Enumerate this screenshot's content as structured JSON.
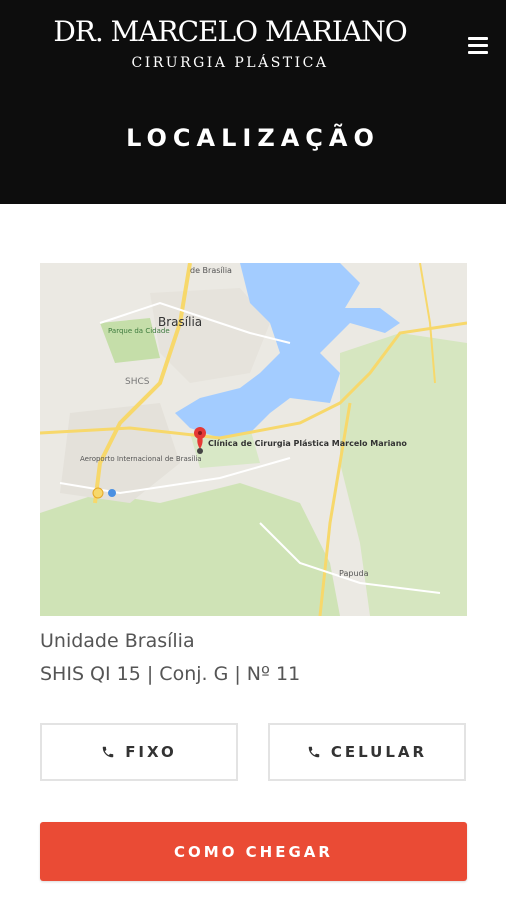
{
  "header": {
    "logo_title": "DR. MARCELO MARIANO",
    "logo_subtitle": "CIRURGIA PLÁSTICA",
    "menu_icon": "hamburger-icon",
    "page_title": "LOCALIZAÇÃO",
    "background": "#0d0d0d"
  },
  "map": {
    "labels": {
      "brasilia": "Brasília",
      "parque": "Parque da Cidade",
      "shcs": "SHCS",
      "aeroporto": "Aeroporto Internacional de Brasília",
      "clinic": "Clínica de Cirurgia Plástica Marcelo Mariano",
      "papuda": "Papuda",
      "debrasilia": "de Brasília"
    },
    "marker_icon": "map-pin-icon"
  },
  "address": {
    "name": "Unidade Brasília",
    "line": "SHIS QI 15 | Conj. G | Nº 11"
  },
  "buttons": {
    "fixo": "FIXO",
    "celular": "CELULAR",
    "como_chegar": "COMO CHEGAR",
    "phone_icon": "phone-icon"
  },
  "colors": {
    "accent": "#ea4b35",
    "lake": "#a3ccff",
    "park": "#c8dfb0"
  }
}
